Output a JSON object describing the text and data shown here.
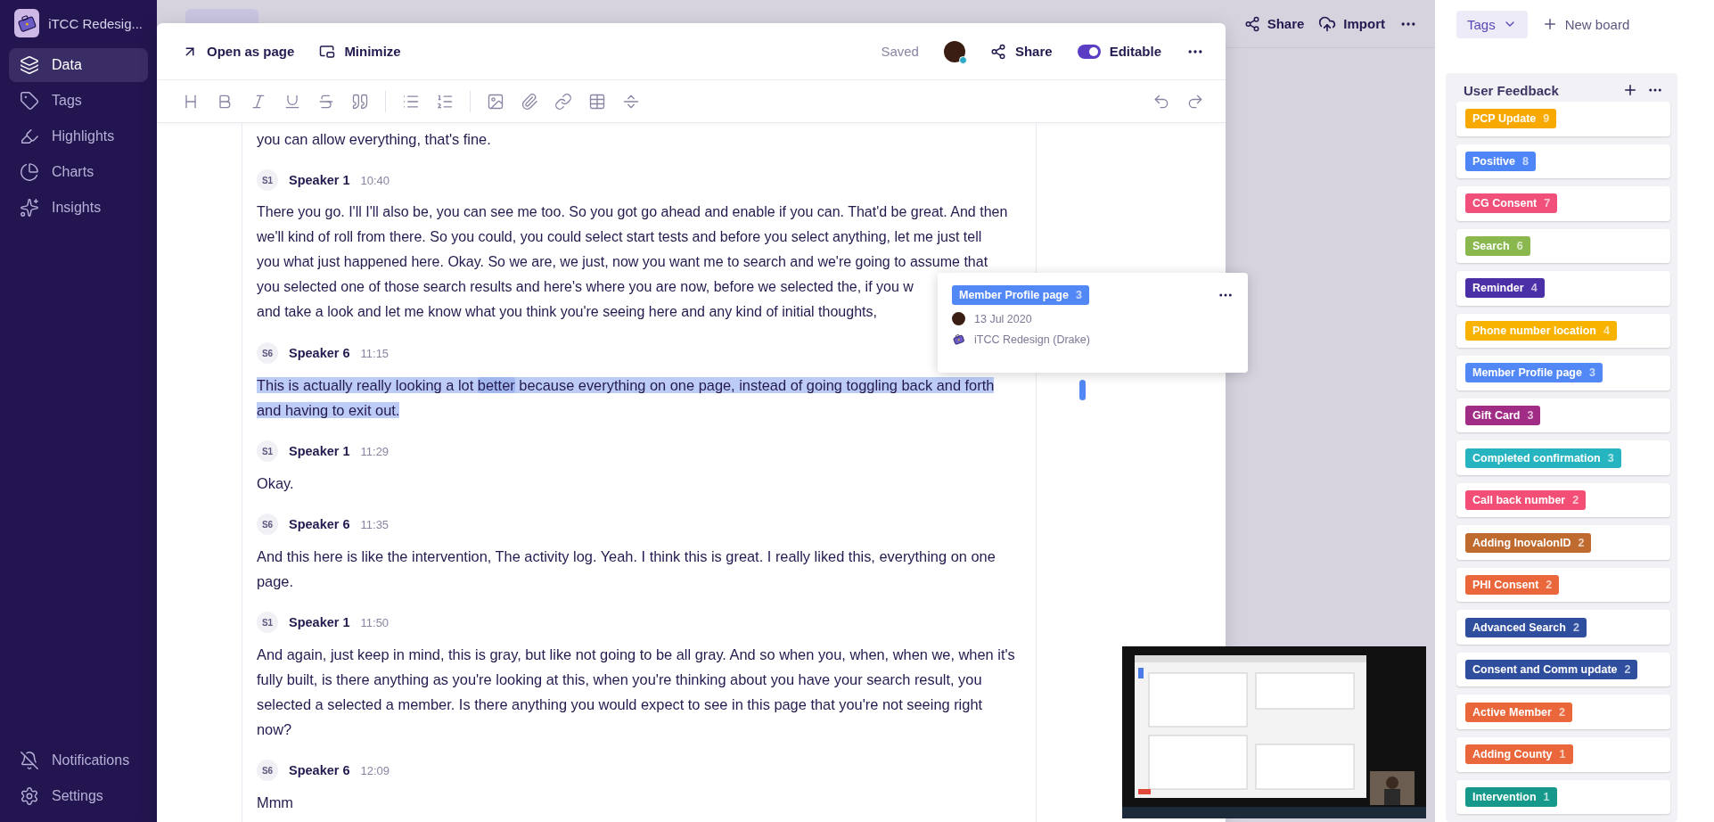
{
  "sidebar": {
    "project": "iTCC Redesig...",
    "items": [
      {
        "label": "Data",
        "selected": true
      },
      {
        "label": "Tags",
        "selected": false
      },
      {
        "label": "Highlights",
        "selected": false
      },
      {
        "label": "Charts",
        "selected": false
      },
      {
        "label": "Insights",
        "selected": false
      }
    ],
    "bottom_items": [
      {
        "label": "Notifications"
      },
      {
        "label": "Settings"
      }
    ]
  },
  "top_bar": {
    "share": "Share",
    "import": "Import"
  },
  "modal": {
    "open_as_page": "Open as page",
    "minimize": "Minimize",
    "status": "Saved",
    "share": "Share",
    "editable": {
      "label": "Editable",
      "on": true
    },
    "transcript": [
      {
        "paragraph": [
          {
            "text": "you can allow everything, that's fine.",
            "marked": false
          }
        ],
        "highlighted": false
      },
      {
        "initials": "S1",
        "speaker": "Speaker 1",
        "time": "10:40",
        "lines": [
          "There you go. I'll I'll also be, you can see me too. So you got go ahead and enable if you can. That'd be great. And then",
          "we'll kind of roll from there. So you could, you could select start tests and before you select anything, let me just tell",
          "you what just happened here. Okay. So we are, we just, now you want me to search and we're going to assume that",
          "you selected one of those search results and here's where you are now, before we selected the, if you w",
          "and take a look and let me know what you think you're seeing here and any kind of initial thoughts,"
        ],
        "highlighted": false
      },
      {
        "initials": "S6",
        "speaker": "Speaker 6",
        "time": "11:15",
        "paragraph": [
          {
            "text": "This is actually really looking a lot ",
            "marked": false
          },
          {
            "text": "better",
            "marked": true
          },
          {
            "text": " because everything on one page, instead of going toggling back and forth and having to exit out.",
            "marked": false
          }
        ],
        "highlighted": true
      },
      {
        "initials": "S1",
        "speaker": "Speaker 1",
        "time": "11:29",
        "paragraph": [
          {
            "text": "Okay.",
            "marked": false
          }
        ],
        "highlighted": false
      },
      {
        "initials": "S6",
        "speaker": "Speaker 6",
        "time": "11:35",
        "paragraph": [
          {
            "text": "And this here is like the intervention, The activity log. Yeah. I think this is great. I really liked this, everything on one page.",
            "marked": false
          }
        ],
        "highlighted": false
      },
      {
        "initials": "S1",
        "speaker": "Speaker 1",
        "time": "11:50",
        "paragraph": [
          {
            "text": "And again, just keep in mind, this is gray, but like not going to be all gray. And so when you, when, when we, when it's fully built, is there anything as you're looking at this, when you're thinking about you have your search result, you selected a selected a member. Is there anything you would expect to see in this page that you're not seeing right now?",
            "marked": false
          }
        ],
        "highlighted": false
      },
      {
        "initials": "S6",
        "speaker": "Speaker 6",
        "time": "12:09",
        "paragraph": [
          {
            "text": "Mmm",
            "marked": false
          }
        ],
        "highlighted": false
      }
    ]
  },
  "popover": {
    "tag": {
      "name": "Member Profile page",
      "count": "3",
      "color": "#5288f5"
    },
    "date": "13 Jul 2020",
    "project": "iTCC Redesign (Drake)"
  },
  "board": {
    "view": "Tags",
    "new_board": "New board",
    "column": "User Feedback",
    "tags": [
      {
        "name": "PCP Update",
        "count": "9",
        "color": "#f8a900"
      },
      {
        "name": "Positive",
        "count": "8",
        "color": "#4f86f7"
      },
      {
        "name": "CG Consent",
        "count": "7",
        "color": "#f0507a"
      },
      {
        "name": "Search",
        "count": "6",
        "color": "#8ab84f"
      },
      {
        "name": "Reminder",
        "count": "4",
        "color": "#4b2fa6"
      },
      {
        "name": "Phone number location",
        "count": "4",
        "color": "#f8b300"
      },
      {
        "name": "Member Profile page",
        "count": "3",
        "color": "#5288f5"
      },
      {
        "name": "Gift Card",
        "count": "3",
        "color": "#a02c85"
      },
      {
        "name": "Completed confirmation",
        "count": "3",
        "color": "#26b5c0"
      },
      {
        "name": "Call back number",
        "count": "2",
        "color": "#f34f76"
      },
      {
        "name": "Adding InovalonID",
        "count": "2",
        "color": "#bf6a2e"
      },
      {
        "name": "PHI Consent",
        "count": "2",
        "color": "#e9673a"
      },
      {
        "name": "Advanced Search",
        "count": "2",
        "color": "#2f4f9e"
      },
      {
        "name": "Consent and Comm update",
        "count": "2",
        "color": "#2f4f9e"
      },
      {
        "name": "Active Member",
        "count": "2",
        "color": "#e9673a"
      },
      {
        "name": "Adding County",
        "count": "1",
        "color": "#e9673a"
      },
      {
        "name": "Intervention",
        "count": "1",
        "color": "#16998a"
      }
    ]
  }
}
